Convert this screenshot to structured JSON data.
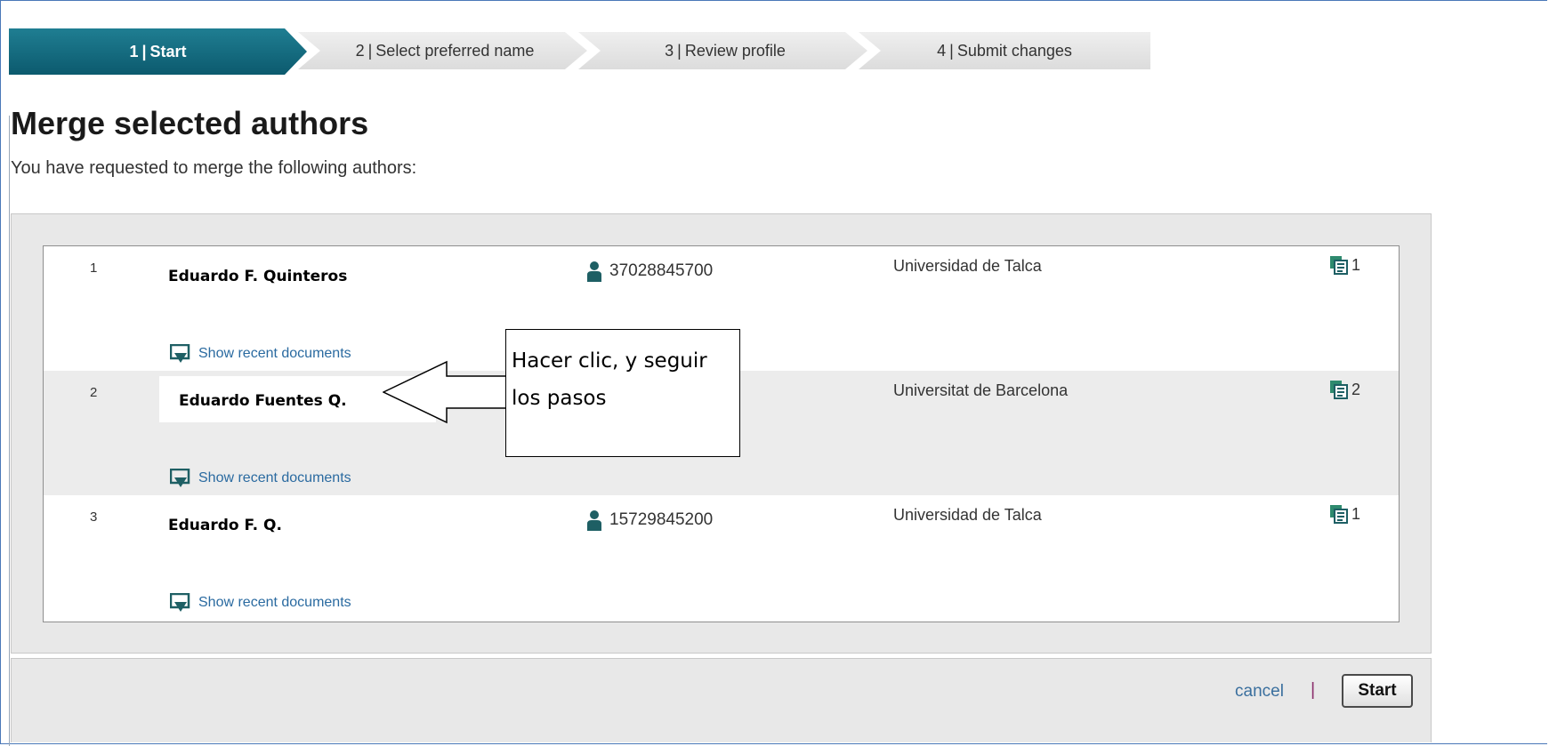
{
  "stepper": [
    {
      "num": "1",
      "sep": "|",
      "label": "Start"
    },
    {
      "num": "2",
      "sep": "|",
      "label": "Select preferred name"
    },
    {
      "num": "3",
      "sep": "|",
      "label": "Review profile"
    },
    {
      "num": "4",
      "sep": "|",
      "label": "Submit changes"
    }
  ],
  "page": {
    "title": "Merge selected authors",
    "subtitle": "You have requested to merge the following authors:"
  },
  "authors": [
    {
      "index": "1",
      "name": "Eduardo F. Quinteros",
      "author_id": "37028845700",
      "affiliation": "Universidad de Talca",
      "documents": "1",
      "show_label": "Show recent documents"
    },
    {
      "index": "2",
      "name": "Eduardo Fuentes Q.",
      "author_id": "",
      "affiliation": "Universitat de Barcelona",
      "documents": "2",
      "show_label": "Show recent documents"
    },
    {
      "index": "3",
      "name": "Eduardo F. Q.",
      "author_id": "15729845200",
      "affiliation": "Universidad de Talca",
      "documents": "1",
      "show_label": "Show recent documents"
    }
  ],
  "footer": {
    "cancel_label": "cancel",
    "separator": "|",
    "start_label": "Start"
  },
  "callout": {
    "line1": "Hacer clic, y seguir",
    "line2": "los pasos"
  },
  "colors": {
    "accent": "#0c5a6e",
    "link": "#2a6aa0",
    "icon": "#1e5f64"
  },
  "icons": {
    "author": "person-icon",
    "docs": "document-stack-icon",
    "show": "expand-down-icon"
  }
}
